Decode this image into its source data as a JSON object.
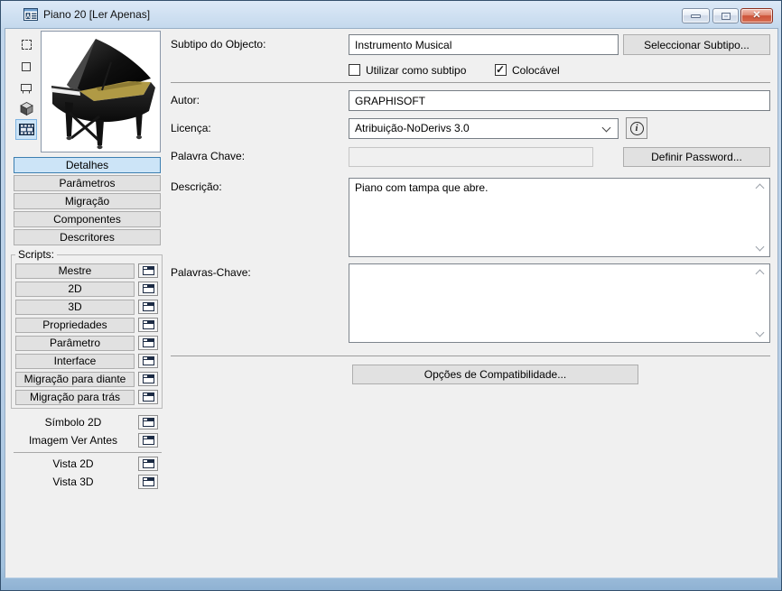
{
  "window": {
    "title": "Piano 20 [Ler Apenas]",
    "controls": {
      "minimize_icon": "minimize-icon",
      "maximize_icon": "maximize-icon",
      "close_icon": "close-icon",
      "close_glyph": "✕"
    },
    "app_icon": "gdl-object-icon"
  },
  "colors": {
    "titlebar_top": "#dce9f7",
    "titlebar_bottom": "#a3c2de",
    "client_bg": "#f0f0f0",
    "selected_tab_bg": "#cce4f7",
    "selected_tab_border": "#3c7fb1",
    "close_button": "#cc533a"
  },
  "sidebar": {
    "preview_icons": [
      "symbol-2d-icon",
      "plan-view-icon",
      "elevation-view-icon",
      "cube-3d-icon",
      "film-preview-icon"
    ],
    "selected_preview_icon": "film-preview-icon",
    "preview_image": "grand-piano-render",
    "tabs": [
      "Detalhes",
      "Parâmetros",
      "Migração",
      "Componentes",
      "Descritores"
    ],
    "selected_tab": "Detalhes",
    "scripts_group_label": "Scripts:",
    "scripts": [
      "Mestre",
      "2D",
      "3D",
      "Propriedades",
      "Parâmetro",
      "Interface",
      "Migração para diante",
      "Migração para trás"
    ],
    "view_labels": [
      "Símbolo 2D",
      "Imagem Ver Antes"
    ],
    "view_labels2": [
      "Vista 2D",
      "Vista 3D"
    ]
  },
  "form": {
    "subtype_label": "Subtipo do Objecto:",
    "subtype_value": "Instrumento Musical",
    "select_subtype_button": "Seleccionar Subtipo...",
    "use_as_subtype_label": "Utilizar como subtipo",
    "use_as_subtype_checked": false,
    "placeable_label": "Colocável",
    "placeable_checked": true,
    "author_label": "Autor:",
    "author_value": "GRAPHISOFT",
    "license_label": "Licença:",
    "license_value": "Atribuição-NoDerivs 3.0",
    "license_info_icon": "info-icon",
    "password_label": "Palavra Chave:",
    "password_value": "",
    "set_password_button": "Definir Password...",
    "description_label": "Descrição:",
    "description_value": "Piano com tampa que abre.",
    "keywords_label": "Palavras-Chave:",
    "keywords_value": "",
    "compatibility_button": "Opções de Compatibilidade..."
  }
}
